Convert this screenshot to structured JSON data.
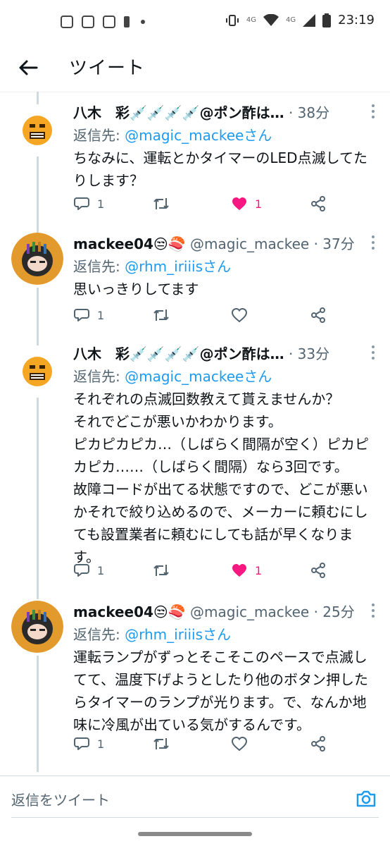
{
  "status_bar": {
    "time": "23:19",
    "network": "4G"
  },
  "header": {
    "title": "ツイート"
  },
  "tweets": [
    {
      "name": "八木　彩💉💉💉💉@ポン酢は…",
      "handle": "",
      "time": "· 38分",
      "reply_prefix": "返信先: ",
      "reply_to": "@magic_mackeeさん",
      "text": "ちなみに、運転とかタイマーのLED点滅してたりします？",
      "reply_count": "1",
      "retweet_count": "",
      "like_count": "1",
      "liked": true
    },
    {
      "name": "mackee04😒🍣",
      "handle": "@magic_mackee",
      "time": " · 37分",
      "reply_prefix": "返信先: ",
      "reply_to": "@rhm_iriiisさん",
      "text": "思いっきりしてます",
      "reply_count": "1",
      "retweet_count": "",
      "like_count": "",
      "liked": false
    },
    {
      "name": "八木　彩💉💉💉💉@ポン酢は…",
      "handle": "",
      "time": "· 33分",
      "reply_prefix": "返信先: ",
      "reply_to": "@magic_mackeeさん",
      "text": "それぞれの点滅回数教えて貰えませんか？\nそれでどこが悪いかわかります。\nピカピカピカ…（しばらく間隔が空く）ピカピカピカ……（しばらく間隔）なら3回です。\n故障コードが出てる状態ですので、どこが悪いかそれで絞り込めるので、メーカーに頼むにしても設置業者に頼むにしても話が早くなります。",
      "reply_count": "1",
      "retweet_count": "",
      "like_count": "1",
      "liked": true
    },
    {
      "name": "mackee04😒🍣",
      "handle": "@magic_mackee",
      "time": " · 25分",
      "reply_prefix": "返信先: ",
      "reply_to": "@rhm_iriiisさん",
      "text": "運転ランプがずっとそこそこのペースで点滅してて、温度下げようとしたり他のボタン押したらタイマーのランプが光ります。で、なんか地味に冷風が出ている気がするんです。",
      "reply_count": "1",
      "retweet_count": "",
      "like_count": "",
      "liked": false
    }
  ],
  "compose": {
    "placeholder": "返信をツイート"
  },
  "colors": {
    "accent": "#1d9bf0",
    "like": "#f91880",
    "muted": "#536471"
  },
  "icons": [
    "back-arrow-icon",
    "reply-icon",
    "retweet-icon",
    "like-icon",
    "share-icon",
    "more-icon",
    "camera-icon"
  ]
}
